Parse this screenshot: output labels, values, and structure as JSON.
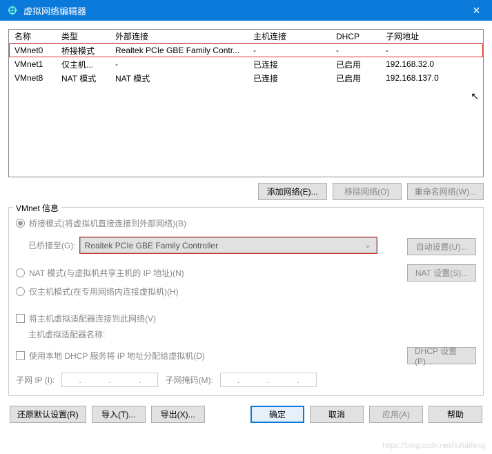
{
  "titlebar": {
    "title": "虚拟网络编辑器",
    "close": "✕",
    "icon_alt": "network-icon"
  },
  "table": {
    "headers": {
      "name": "名称",
      "type": "类型",
      "ext": "外部连接",
      "host": "主机连接",
      "dhcp": "DHCP",
      "subnet": "子网地址"
    },
    "rows": [
      {
        "name": "VMnet0",
        "type": "桥接模式",
        "ext": "Realtek PCIe GBE Family Contr...",
        "host": "-",
        "dhcp": "-",
        "subnet": "-"
      },
      {
        "name": "VMnet1",
        "type": "仅主机...",
        "ext": "-",
        "host": "已连接",
        "dhcp": "已启用",
        "subnet": "192.168.32.0"
      },
      {
        "name": "VMnet8",
        "type": "NAT 模式",
        "ext": "NAT 模式",
        "host": "已连接",
        "dhcp": "已启用",
        "subnet": "192.168.137.0"
      }
    ]
  },
  "buttons": {
    "add_net": "添加网络(E)...",
    "remove_net": "移除网络(O)",
    "rename_net": "重命名网络(W)...",
    "auto_set": "自动设置(U)...",
    "nat_set": "NAT 设置(S)...",
    "dhcp_set": "DHCP 设置(P)...",
    "restore": "还原默认设置(R)",
    "import": "导入(T)...",
    "export": "导出(X)...",
    "ok": "确定",
    "cancel": "取消",
    "apply": "应用(A)",
    "help": "帮助"
  },
  "info": {
    "legend": "VMnet 信息",
    "bridge_radio": "桥接模式(将虚拟机直接连接到外部网络)(B)",
    "bridged_to": "已桥接至(G):",
    "bridge_value": "Realtek PCIe GBE Family Controller",
    "nat_radio": "NAT 模式(与虚拟机共享主机的 IP 地址)(N)",
    "hostonly_radio": "仅主机模式(在专用网络内连接虚拟机)(H)",
    "connect_host": "将主机虚拟适配器连接到此网络(V)",
    "host_adapter_label": "主机虚拟适配器名称:",
    "use_dhcp": "使用本地 DHCP 服务将 IP 地址分配给虚拟机(D)",
    "subnet_ip_label": "子网 IP (I):",
    "subnet_mask_label": "子网掩码(M):",
    "ip_dots": "."
  },
  "watermark": "https://blog.csdn.net/liuhaifeng"
}
